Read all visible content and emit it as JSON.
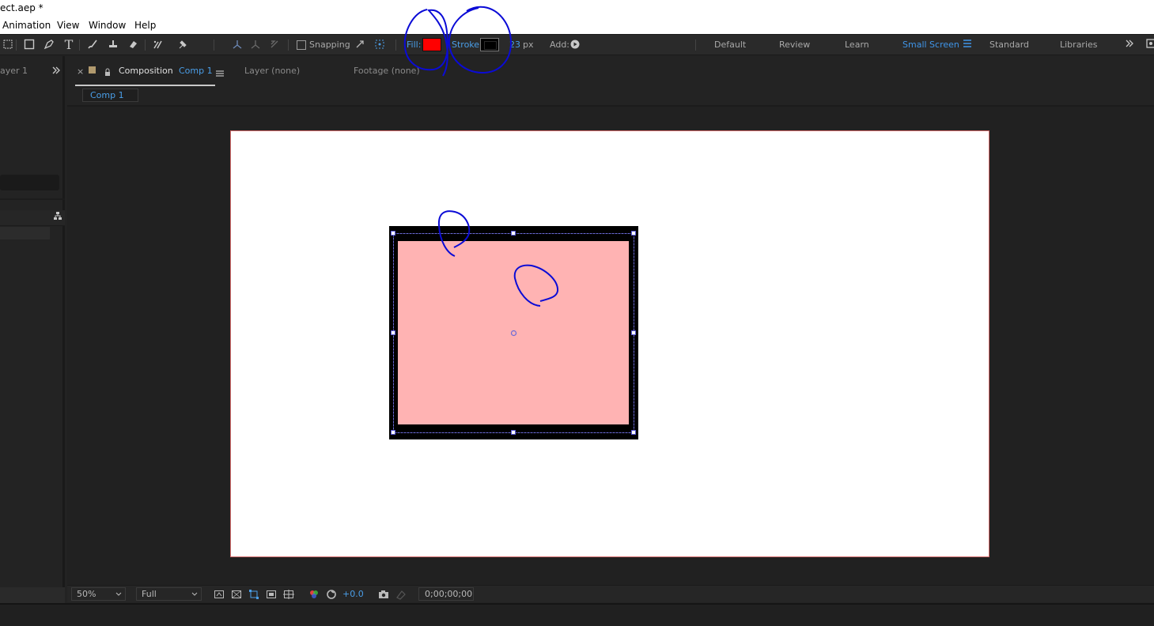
{
  "window": {
    "title": "ect.aep *"
  },
  "menu": {
    "items": [
      "Animation",
      "View",
      "Window",
      "Help"
    ]
  },
  "toolbar": {
    "snapping_label": "Snapping",
    "fill_label": "Fill:",
    "fill_color": "#ff0000",
    "stroke_label": "Stroke:",
    "stroke_color": "#000000",
    "stroke_width": "23",
    "stroke_unit": "px",
    "add_label": "Add:"
  },
  "workspaces": {
    "items": [
      "Default",
      "Review",
      "Learn",
      "Small Screen",
      "Standard",
      "Libraries"
    ],
    "active": "Small Screen"
  },
  "left_panel": {
    "tab_label": "ayer 1"
  },
  "comp_panel": {
    "tab_prefix": "Composition",
    "tab_comp_name": "Comp 1",
    "layer_tab": "Layer",
    "layer_value": "(none)",
    "footage_tab": "Footage",
    "footage_value": "(none)",
    "subtab": "Comp 1"
  },
  "viewer_bar": {
    "zoom": "50%",
    "resolution": "Full",
    "exposure": "+0.0",
    "timecode": "0;00;00;00"
  },
  "shape": {
    "fill_color": "#ffb3b3",
    "stroke_color": "#000000"
  }
}
